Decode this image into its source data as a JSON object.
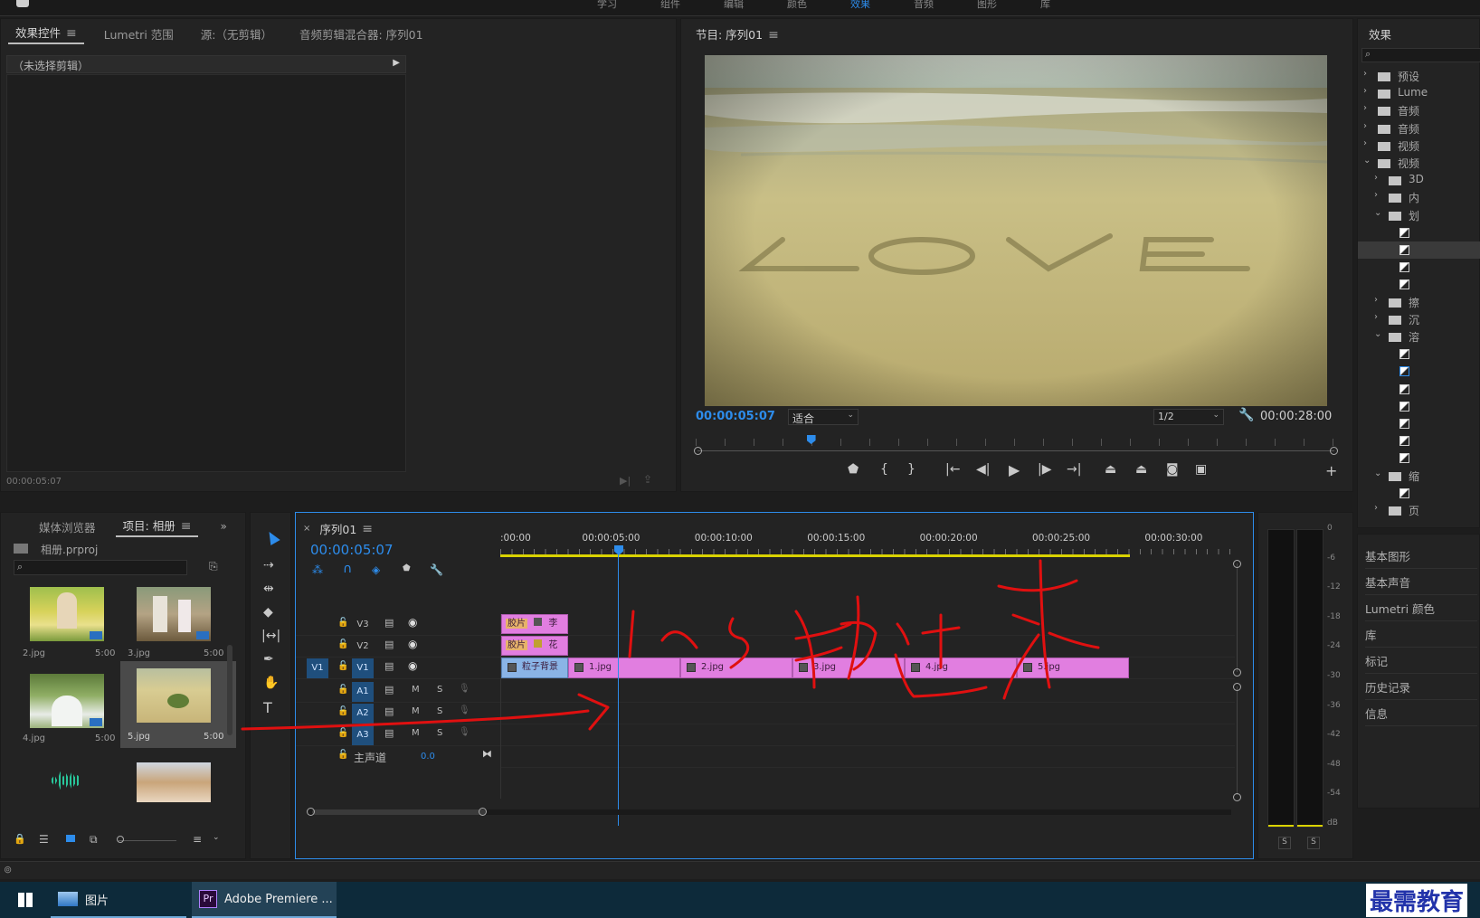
{
  "top_menu": [
    "学习",
    "组件",
    "编辑",
    "颜色",
    "效果",
    "音频",
    "图形",
    "库"
  ],
  "top_menu_active": "效果",
  "effect_controls": {
    "tabs": [
      "效果控件",
      "Lumetri 范围",
      "源:（无剪辑）",
      "音频剪辑混合器: 序列01"
    ],
    "no_clip": "（未选择剪辑）",
    "timecode": "00:00:05:07"
  },
  "program_monitor": {
    "title": "节目: 序列01",
    "timecode_current": "00:00:05:07",
    "fit": "适合",
    "resolution": "1/2",
    "timecode_total": "00:00:28:00",
    "playhead_fraction": 0.182
  },
  "effects_panel": {
    "title": "效果",
    "items": [
      {
        "label": "预设",
        "indent": 0,
        "kind": "folder-star",
        "expanded": false
      },
      {
        "label": "Lume",
        "indent": 0,
        "kind": "folder-star",
        "expanded": false
      },
      {
        "label": "音频",
        "indent": 0,
        "kind": "folder",
        "expanded": false
      },
      {
        "label": "音频",
        "indent": 0,
        "kind": "folder",
        "expanded": false
      },
      {
        "label": "视频",
        "indent": 0,
        "kind": "folder",
        "expanded": false
      },
      {
        "label": "视频",
        "indent": 0,
        "kind": "folder",
        "expanded": true
      },
      {
        "label": "3D",
        "indent": 1,
        "kind": "folder",
        "expanded": false
      },
      {
        "label": "内",
        "indent": 1,
        "kind": "folder",
        "expanded": false
      },
      {
        "label": "划",
        "indent": 1,
        "kind": "folder",
        "expanded": true
      },
      {
        "label": "",
        "indent": 2,
        "kind": "fx"
      },
      {
        "label": "",
        "indent": 2,
        "kind": "fx",
        "selected": true
      },
      {
        "label": "",
        "indent": 2,
        "kind": "fx"
      },
      {
        "label": "",
        "indent": 2,
        "kind": "fx"
      },
      {
        "label": "擦",
        "indent": 1,
        "kind": "folder",
        "expanded": false
      },
      {
        "label": "沉",
        "indent": 1,
        "kind": "folder",
        "expanded": false
      },
      {
        "label": "溶",
        "indent": 1,
        "kind": "folder",
        "expanded": true
      },
      {
        "label": "",
        "indent": 2,
        "kind": "fx"
      },
      {
        "label": "",
        "indent": 2,
        "kind": "fx-blue"
      },
      {
        "label": "",
        "indent": 2,
        "kind": "fx"
      },
      {
        "label": "",
        "indent": 2,
        "kind": "fx"
      },
      {
        "label": "",
        "indent": 2,
        "kind": "fx"
      },
      {
        "label": "",
        "indent": 2,
        "kind": "fx"
      },
      {
        "label": "",
        "indent": 2,
        "kind": "fx"
      },
      {
        "label": "缩",
        "indent": 1,
        "kind": "folder",
        "expanded": true
      },
      {
        "label": "",
        "indent": 2,
        "kind": "fx"
      },
      {
        "label": "页",
        "indent": 1,
        "kind": "folder",
        "expanded": false
      }
    ],
    "side_links": [
      "基本图形",
      "基本声音",
      "Lumetri 颜色",
      "库",
      "标记",
      "历史记录",
      "信息"
    ]
  },
  "project": {
    "tabs": [
      "媒体浏览器",
      "项目: 相册"
    ],
    "file": "相册.prproj",
    "thumbs": [
      {
        "name": "2.jpg",
        "dur": "5:00"
      },
      {
        "name": "3.jpg",
        "dur": "5:00"
      },
      {
        "name": "4.jpg",
        "dur": "5:00"
      },
      {
        "name": "5.jpg",
        "dur": "5:00"
      },
      {
        "name": "",
        "dur": ""
      },
      {
        "name": "",
        "dur": ""
      }
    ]
  },
  "timeline": {
    "tab": "序列01",
    "timecode": "00:00:05:07",
    "ruler": [
      ":00:00",
      "00:00:05:00",
      "00:00:10:00",
      "00:00:15:00",
      "00:00:20:00",
      "00:00:25:00",
      "00:00:30:00"
    ],
    "tracks": {
      "v3": "V3",
      "v2": "V2",
      "v1": "V1",
      "v1_src": "V1",
      "a1": "A1",
      "a2": "A2",
      "a3": "A3",
      "m": "M",
      "s": "S",
      "master": "主声道",
      "master_val": "0.0"
    },
    "v3_clip": {
      "tag": "胶片",
      "text": "李"
    },
    "v2_clip": {
      "tag": "胶片",
      "text": "花"
    },
    "v1_clips": [
      "粒子背景",
      "1.jpg",
      "2.jpg",
      "3.jpg",
      "4.jpg",
      "5.jpg"
    ]
  },
  "meter": {
    "scale": [
      "0",
      "-6",
      "-12",
      "-18",
      "-24",
      "-30",
      "-36",
      "-42",
      "-48",
      "-54",
      "dB"
    ],
    "solo": [
      "S",
      "S"
    ]
  },
  "annotation_text": "1~5 拖过来",
  "taskbar": {
    "photos": "图片",
    "premiere": "Adobe Premiere ...",
    "watermark": "最需教育"
  },
  "colors": {
    "accent": "#2d8ceb",
    "clip_pink": "#e17ee0",
    "annotation": "#e01010"
  }
}
